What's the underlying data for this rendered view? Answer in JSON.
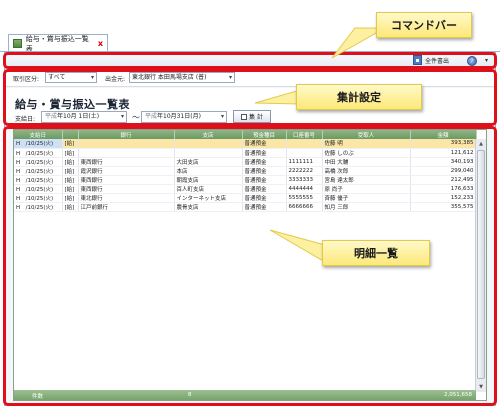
{
  "tab": {
    "title": "給与・賞与振込一覧表",
    "close": "x"
  },
  "command_bar": {
    "export_label": "全件書出",
    "help_caret": "▾"
  },
  "filter": {
    "type_label": "取引区分:",
    "type_value": "すべて",
    "account_label": "出金元:",
    "account_value": "東北銀行 本田馬場支店 (普)"
  },
  "summary": {
    "title": "給与・賞与振込一覧表",
    "pay_date_label": "支給日:",
    "date_from_era": "平成",
    "date_from": "年10月 1日(土)",
    "tilde": "〜",
    "date_to_era": "平成",
    "date_to": "年10月31日(月)",
    "aggregate_button": "集 計"
  },
  "grid": {
    "columns": [
      "支給日",
      "",
      "銀行",
      "支店",
      "預金種目",
      "口座番号",
      "受取人",
      "金額"
    ],
    "rows": [
      [
        "H　/10/25(火)",
        "[給]",
        "",
        "",
        "普通預金",
        "",
        "佐藤 明",
        "393,385"
      ],
      [
        "H　/10/25(火)",
        "[給]",
        "",
        "",
        "普通預金",
        "",
        "佐藤 しのぶ",
        "121,612"
      ],
      [
        "H　/10/25(火)",
        "[給]",
        "東西銀行",
        "大田支店",
        "普通預金",
        "1111111",
        "中田 大輔",
        "340,193"
      ],
      [
        "H　/10/25(火)",
        "[給]",
        "霞沢銀行",
        "本店",
        "普通預金",
        "2222222",
        "高橋 次郎",
        "299,040"
      ],
      [
        "H　/10/25(火)",
        "[給]",
        "東西銀行",
        "朝霞支店",
        "普通預金",
        "3333333",
        "宮島 達太郎",
        "212,495"
      ],
      [
        "H　/10/25(火)",
        "[給]",
        "東西銀行",
        "百人町支店",
        "普通預金",
        "4444444",
        "原 尚子",
        "176,633"
      ],
      [
        "H　/10/25(火)",
        "[給]",
        "東北銀行",
        "インターネット支店",
        "普通預金",
        "5555555",
        "斉藤 優子",
        "152,233"
      ],
      [
        "H　/10/25(火)",
        "[給]",
        "江戸前銀行",
        "農骨支店",
        "普通預金",
        "6666666",
        "知月 三郎",
        "355,575"
      ]
    ],
    "footer_count_label": "件数",
    "footer_count": "8",
    "footer_total": "2,051,658"
  },
  "callouts": {
    "command_bar": "コマンドバー",
    "summary_settings": "集計設定",
    "detail_list": "明細一覧"
  },
  "colors": {
    "callout_border": "#e0101a",
    "grid_header": "#7aa56f",
    "selected_row": "#fbe6a8"
  }
}
